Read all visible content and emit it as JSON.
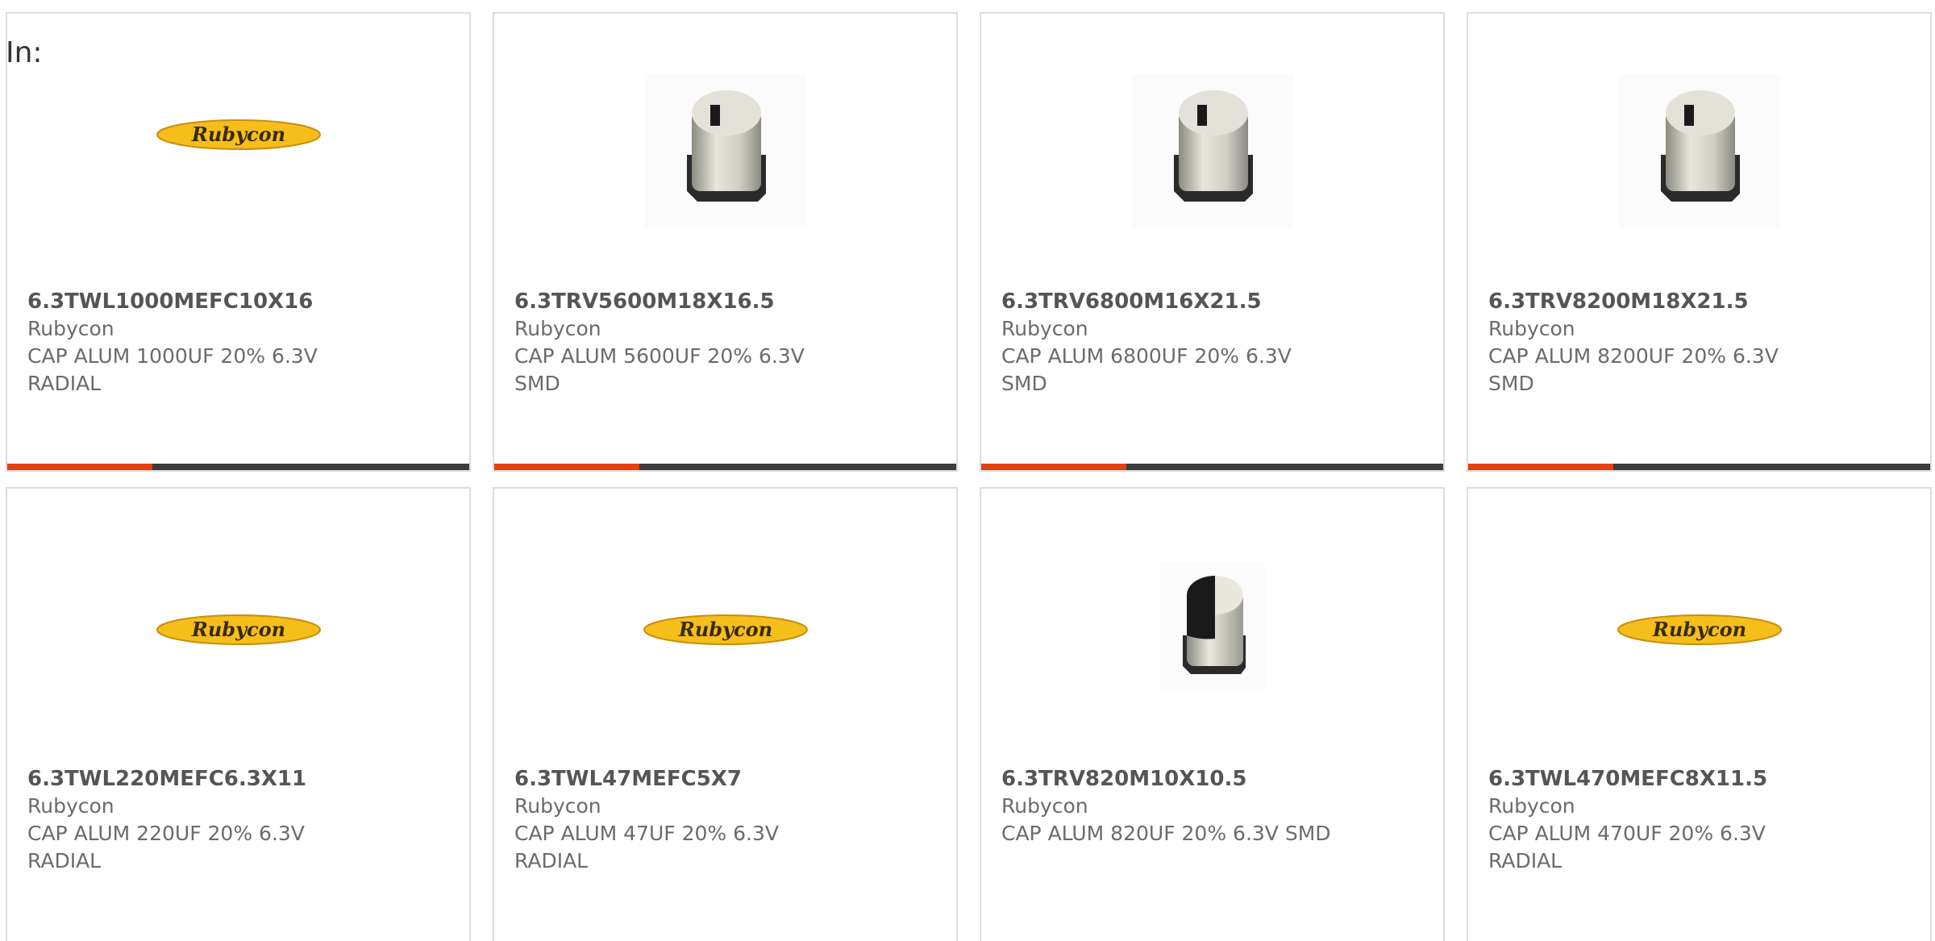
{
  "header": {
    "label": "In:"
  },
  "products": [
    {
      "part": "6.3TWL1000MEFC10X16",
      "manufacturer": "Rubycon",
      "desc1": "CAP ALUM 1000UF 20% 6.3V",
      "desc2": "RADIAL",
      "image": "rubycon-logo",
      "logo_text": "Rubycon",
      "progress": 0.315
    },
    {
      "part": "6.3TRV5600M18X16.5",
      "manufacturer": "Rubycon",
      "desc1": "CAP ALUM 5600UF 20% 6.3V",
      "desc2": "SMD",
      "image": "smd-capacitor",
      "progress": 0.315
    },
    {
      "part": "6.3TRV6800M16X21.5",
      "manufacturer": "Rubycon",
      "desc1": "CAP ALUM 6800UF 20% 6.3V",
      "desc2": "SMD",
      "image": "smd-capacitor",
      "progress": 0.315
    },
    {
      "part": "6.3TRV8200M18X21.5",
      "manufacturer": "Rubycon",
      "desc1": "CAP ALUM 8200UF 20% 6.3V",
      "desc2": "SMD",
      "image": "smd-capacitor",
      "progress": 0.315
    },
    {
      "part": "6.3TWL220MEFC6.3X11",
      "manufacturer": "Rubycon",
      "desc1": "CAP ALUM 220UF 20% 6.3V",
      "desc2": "RADIAL",
      "image": "rubycon-logo",
      "logo_text": "Rubycon"
    },
    {
      "part": "6.3TWL47MEFC5X7",
      "manufacturer": "Rubycon",
      "desc1": "CAP ALUM 47UF 20% 6.3V",
      "desc2": "RADIAL",
      "image": "rubycon-logo",
      "logo_text": "Rubycon"
    },
    {
      "part": "6.3TRV820M10X10.5",
      "manufacturer": "Rubycon",
      "desc1": "CAP ALUM 820UF 20% 6.3V SMD",
      "desc2": "",
      "image": "smd-capacitor-small"
    },
    {
      "part": "6.3TWL470MEFC8X11.5",
      "manufacturer": "Rubycon",
      "desc1": "CAP ALUM 470UF 20% 6.3V",
      "desc2": "RADIAL",
      "image": "rubycon-logo",
      "logo_text": "Rubycon"
    }
  ],
  "colors": {
    "accent": "#e6400f",
    "bar_track": "#3c3c3c",
    "logo_yellow": "#f5be1b",
    "logo_text": "#3a2a10"
  }
}
